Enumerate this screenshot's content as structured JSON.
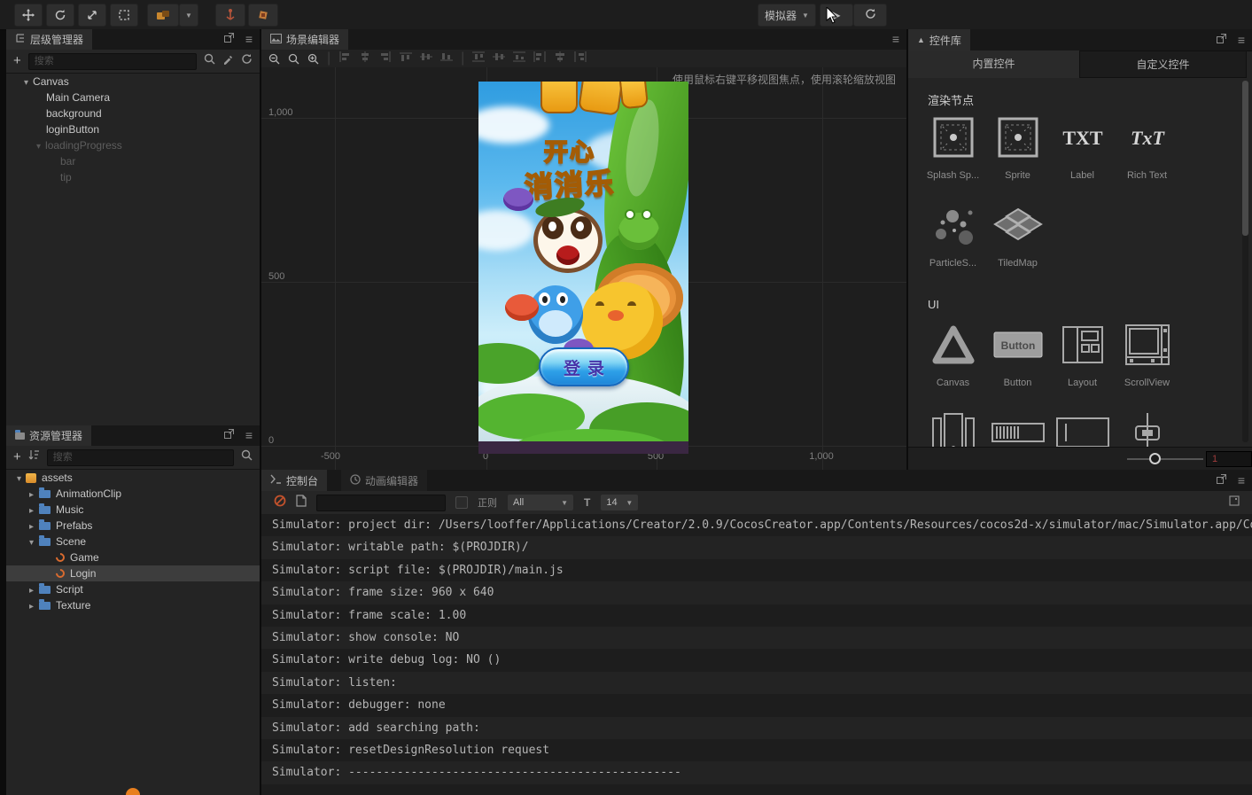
{
  "toolbar": {
    "simulator_label": "模拟器"
  },
  "hierarchy": {
    "title": "层级管理器",
    "search_placeholder": "搜索",
    "nodes": [
      {
        "label": "Canvas"
      },
      {
        "label": "Main Camera"
      },
      {
        "label": "background"
      },
      {
        "label": "loginButton"
      },
      {
        "label": "loadingProgress"
      },
      {
        "label": "bar"
      },
      {
        "label": "tip"
      }
    ]
  },
  "assets": {
    "title": "资源管理器",
    "search_placeholder": "搜索",
    "nodes": [
      {
        "label": "assets"
      },
      {
        "label": "AnimationClip"
      },
      {
        "label": "Music"
      },
      {
        "label": "Prefabs"
      },
      {
        "label": "Scene"
      },
      {
        "label": "Game"
      },
      {
        "label": "Login"
      },
      {
        "label": "Script"
      },
      {
        "label": "Texture"
      }
    ]
  },
  "scene": {
    "tab": "场景编辑器",
    "hint": "使用鼠标右键平移视图焦点，使用滚轮缩放视图",
    "ruler_y": [
      "1,000",
      "500",
      "0"
    ],
    "ruler_x": [
      "-500",
      "0",
      "500",
      "1,000"
    ],
    "preview": {
      "title_top": "开心",
      "title_bottom": "消消乐",
      "login_label": "登录"
    }
  },
  "library": {
    "tab": "控件库",
    "tab_builtin": "内置控件",
    "tab_custom": "自定义控件",
    "section_render": "渲染节点",
    "section_ui": "UI",
    "items_render": [
      "Splash Sp...",
      "Sprite",
      "Label",
      "Rich Text",
      "ParticleS...",
      "TiledMap"
    ],
    "items_ui": [
      "Canvas",
      "Button",
      "Layout",
      "ScrollView"
    ],
    "icon_text_label": "TXT",
    "icon_text_richtext": "TxT",
    "icon_text_button": "Button",
    "zoom_value": "1"
  },
  "console": {
    "tab": "控制台",
    "tab_anim": "动画编辑器",
    "regex_label": "正则",
    "filter_value": "All",
    "font_icon": "T",
    "font_size": "14",
    "lines": [
      "Simulator: project dir: /Users/looffer/Applications/Creator/2.0.9/CocosCreator.app/Contents/Resources/cocos2d-x/simulator/mac/Simulator.app/Co",
      "Simulator: writable path: $(PROJDIR)/",
      "Simulator: script file: $(PROJDIR)/main.js",
      "Simulator: frame size: 960 x 640",
      "Simulator: frame scale: 1.00",
      "Simulator: show console: NO",
      "Simulator: write debug log: NO ()",
      "Simulator: listen:",
      "Simulator: debugger: none",
      "Simulator: add searching path:",
      "Simulator: resetDesignResolution request",
      "Simulator: ------------------------------------------------"
    ]
  }
}
